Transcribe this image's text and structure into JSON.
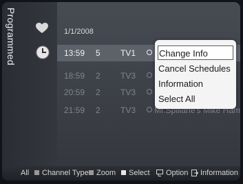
{
  "sidebar": {
    "title": "Programmed"
  },
  "list": {
    "date": "1/1/2008",
    "rows": [
      {
        "time": "13:59",
        "channel": "5",
        "channel_name": "TV1",
        "program": ""
      },
      {
        "time": "18:59",
        "channel": "2",
        "channel_name": "TV3",
        "program": ""
      },
      {
        "time": "20:59",
        "channel": "2",
        "channel_name": "TV3",
        "program": ""
      },
      {
        "time": "21:59",
        "channel": "2",
        "channel_name": "TV3",
        "program": "Mr.Spillane's Mike Hammer"
      }
    ]
  },
  "popup": {
    "items": [
      "Change Info",
      "Cancel Schedules",
      "Information",
      "Select All"
    ]
  },
  "footer": {
    "all": "All",
    "channel_type": "Channel Type",
    "zoom": "Zoom",
    "select": "Select",
    "option": "Option",
    "information": "Information"
  },
  "colors": {
    "selected_row": "#5d6169",
    "popup_bg": "#f4f4f4",
    "dim_text": "#7f848c"
  }
}
